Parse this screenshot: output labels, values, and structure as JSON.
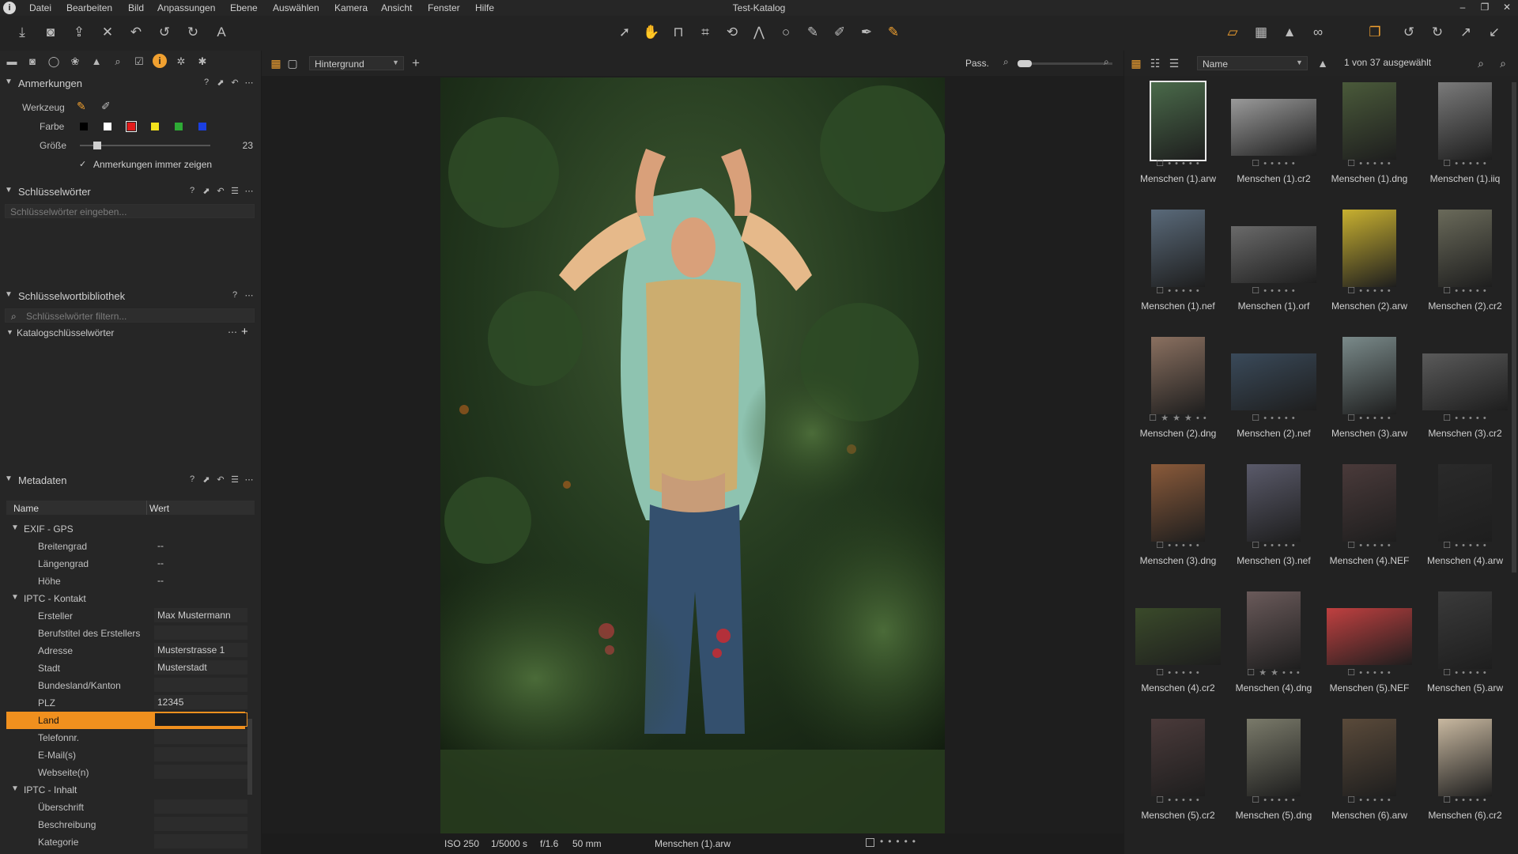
{
  "window": {
    "title": "Test-Katalog",
    "logo": "i"
  },
  "menu": [
    "Datei",
    "Bearbeiten",
    "Bild",
    "Anpassungen",
    "Ebene",
    "Auswählen",
    "Kamera",
    "Ansicht",
    "Fenster",
    "Hilfe"
  ],
  "viewer": {
    "layer": "Hintergrund",
    "zoom_label": "Pass."
  },
  "browser": {
    "sort": "Name",
    "count": "1 von 37 ausgewählt"
  },
  "annotations": {
    "title": "Anmerkungen",
    "tool_label": "Werkzeug",
    "color_label": "Farbe",
    "size_label": "Größe",
    "size_value": "23",
    "size_fraction": 0.1,
    "always_show_label": "Anmerkungen immer zeigen",
    "always_show_checked": true,
    "colors": [
      "#000000",
      "#ffffff",
      "#e21b1b",
      "#f2e21d",
      "#2eaa35",
      "#1b3fe0"
    ]
  },
  "keywords": {
    "title": "Schlüsselwörter",
    "placeholder": "Schlüsselwörter eingeben..."
  },
  "keyword_library": {
    "title": "Schlüsselwortbibliothek",
    "filter_placeholder": "Schlüsselwörter filtern...",
    "catalog_label": "Katalogschlüsselwörter"
  },
  "metadata": {
    "title": "Metadaten",
    "col_name": "Name",
    "col_value": "Wert",
    "groups": [
      {
        "label": "EXIF - GPS",
        "rows": [
          {
            "name": "Breitengrad",
            "value": "--"
          },
          {
            "name": "Längengrad",
            "value": "--"
          },
          {
            "name": "Höhe",
            "value": "--"
          }
        ]
      },
      {
        "label": "IPTC - Kontakt",
        "rows": [
          {
            "name": "Ersteller",
            "value": "Max Mustermann"
          },
          {
            "name": "Berufstitel des Erstellers",
            "value": ""
          },
          {
            "name": "Adresse",
            "value": "Musterstrasse 1"
          },
          {
            "name": "Stadt",
            "value": "Musterstadt"
          },
          {
            "name": "Bundesland/Kanton",
            "value": ""
          },
          {
            "name": "PLZ",
            "value": "12345"
          },
          {
            "name": "Land",
            "value": ""
          },
          {
            "name": "Telefonnr.",
            "value": ""
          },
          {
            "name": "E-Mail(s)",
            "value": ""
          },
          {
            "name": "Webseite(n)",
            "value": ""
          }
        ]
      },
      {
        "label": "IPTC - Inhalt",
        "rows": [
          {
            "name": "Überschrift",
            "value": ""
          },
          {
            "name": "Beschreibung",
            "value": ""
          },
          {
            "name": "Kategorie",
            "value": ""
          }
        ]
      }
    ]
  },
  "status": {
    "iso": "ISO 250",
    "shutter": "1/5000 s",
    "aperture": "f/1.6",
    "focal": "50 mm",
    "filename": "Menschen (1).arw"
  },
  "thumbnails": [
    {
      "name": "Menschen (1).arw",
      "rating": 0,
      "color": "#4a6a4a"
    },
    {
      "name": "Menschen (1).cr2",
      "rating": 0,
      "color": "#9a9a9a"
    },
    {
      "name": "Menschen (1).dng",
      "rating": 0,
      "color": "#4a5a3a"
    },
    {
      "name": "Menschen (1).iiq",
      "rating": 0,
      "color": "#7a7a7a"
    },
    {
      "name": "Menschen (1).nef",
      "rating": 0,
      "color": "#5a6a7a"
    },
    {
      "name": "Menschen (1).orf",
      "rating": 0,
      "color": "#6a6a6a"
    },
    {
      "name": "Menschen (2).arw",
      "rating": 0,
      "color": "#c8b030"
    },
    {
      "name": "Menschen (2).cr2",
      "rating": 0,
      "color": "#6a6a5a"
    },
    {
      "name": "Menschen (2).dng",
      "rating": 3,
      "color": "#8a7060"
    },
    {
      "name": "Menschen (2).nef",
      "rating": 0,
      "color": "#3a4a5a"
    },
    {
      "name": "Menschen (3).arw",
      "rating": 0,
      "color": "#7a8a8a"
    },
    {
      "name": "Menschen (3).cr2",
      "rating": 0,
      "color": "#5a5a5a"
    },
    {
      "name": "Menschen (3).dng",
      "rating": 0,
      "color": "#8a5a3a"
    },
    {
      "name": "Menschen (3).nef",
      "rating": 0,
      "color": "#5a5a6a"
    },
    {
      "name": "Menschen (4).NEF",
      "rating": 0,
      "color": "#4a3a3a"
    },
    {
      "name": "Menschen (4).arw",
      "rating": 0,
      "color": "#2a2a2a"
    },
    {
      "name": "Menschen (4).cr2",
      "rating": 0,
      "color": "#3a4a2a"
    },
    {
      "name": "Menschen (4).dng",
      "rating": 2,
      "color": "#6a5a5a"
    },
    {
      "name": "Menschen (5).NEF",
      "rating": 0,
      "color": "#c04040"
    },
    {
      "name": "Menschen (5).arw",
      "rating": 0,
      "color": "#3a3a3a"
    },
    {
      "name": "Menschen (5).cr2",
      "rating": 0,
      "color": "#4a3a3a"
    },
    {
      "name": "Menschen (5).dng",
      "rating": 0,
      "color": "#7a7a6a"
    },
    {
      "name": "Menschen (6).arw",
      "rating": 0,
      "color": "#5a4a3a"
    },
    {
      "name": "Menschen (6).cr2",
      "rating": 0,
      "color": "#c8b8a0"
    }
  ]
}
